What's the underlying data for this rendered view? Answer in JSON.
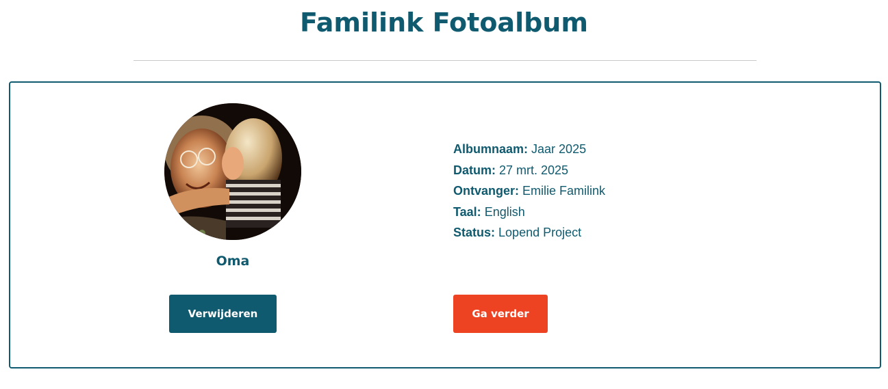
{
  "header": {
    "title": "Familink Fotoalbum"
  },
  "album": {
    "recipient_name": "Oma",
    "avatar_alt": "photo-avatar",
    "details": [
      {
        "label": "Albumnaam:",
        "value": "Jaar 2025"
      },
      {
        "label": "Datum:",
        "value": "27 mrt. 2025"
      },
      {
        "label": "Ontvanger:",
        "value": "Emilie Familink"
      },
      {
        "label": "Taal:",
        "value": "English"
      },
      {
        "label": "Status:",
        "value": "Lopend Project"
      }
    ],
    "delete_label": "Verwijderen",
    "continue_label": "Ga verder"
  },
  "colors": {
    "primary": "#0f5a6e",
    "accent": "#ee4323",
    "divider": "#c9c9c9",
    "background": "#ffffff"
  }
}
